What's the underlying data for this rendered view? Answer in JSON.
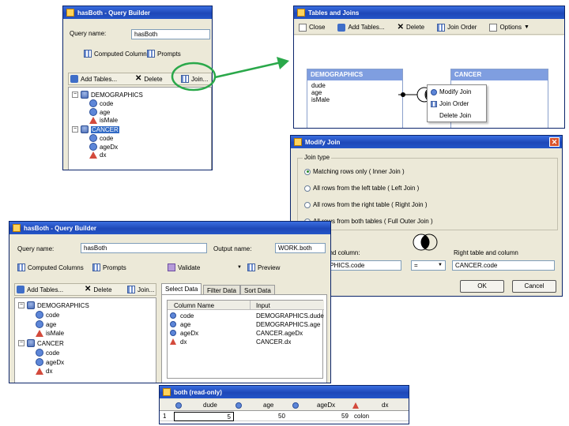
{
  "qb_top": {
    "title": "hasBoth - Query Builder",
    "query_name_label": "Query name:",
    "query_name_value": "hasBoth",
    "computed_columns": "Computed Columns",
    "prompts": "Prompts",
    "add_tables": "Add Tables...",
    "delete": "Delete",
    "join": "Join...",
    "tree": [
      {
        "label": "DEMOGRAPHICS",
        "kind": "table"
      },
      {
        "label": "code",
        "kind": "num"
      },
      {
        "label": "age",
        "kind": "num"
      },
      {
        "label": "isMale",
        "kind": "char"
      },
      {
        "label": "CANCER",
        "kind": "table"
      },
      {
        "label": "code",
        "kind": "num"
      },
      {
        "label": "ageDx",
        "kind": "num"
      },
      {
        "label": "dx",
        "kind": "char"
      }
    ]
  },
  "tj": {
    "title": "Tables and Joins",
    "close": "Close",
    "add_tables": "Add Tables...",
    "delete": "Delete",
    "join_order": "Join Order",
    "options": "Options",
    "demographics_title": "DEMOGRAPHICS",
    "demographics_cols": [
      "dude",
      "age",
      "isMale"
    ],
    "cancer_title": "CANCER",
    "menu": [
      "Modify Join",
      "Join Order",
      "Delete Join"
    ]
  },
  "mj": {
    "title": "Modify Join",
    "group_label": "Join type",
    "options": [
      "Matching rows only ( Inner Join )",
      "All rows from the left table ( Left Join )",
      "All rows from the right table ( Right Join )",
      "All rows from both tables ( Full Outer Join )"
    ],
    "left_label": "and column:",
    "left_value": "APHICS.code",
    "operator_value": "=",
    "right_label": "Right table and column",
    "right_value": "CANCER.code",
    "ok": "OK",
    "cancel": "Cancel"
  },
  "qb_bottom": {
    "title": "hasBoth - Query Builder",
    "query_name_label": "Query name:",
    "query_name_value": "hasBoth",
    "output_name_label": "Output name:",
    "output_name_value": "WORK.both",
    "computed_columns": "Computed Columns",
    "prompts": "Prompts",
    "validate": "Validate",
    "preview": "Preview",
    "add_tables": "Add Tables...",
    "delete": "Delete",
    "join": "Join...",
    "tree": [
      {
        "label": "DEMOGRAPHICS",
        "kind": "table"
      },
      {
        "label": "code",
        "kind": "num"
      },
      {
        "label": "age",
        "kind": "num"
      },
      {
        "label": "isMale",
        "kind": "char"
      },
      {
        "label": "CANCER",
        "kind": "table"
      },
      {
        "label": "code",
        "kind": "num"
      },
      {
        "label": "ageDx",
        "kind": "num"
      },
      {
        "label": "dx",
        "kind": "char"
      }
    ],
    "tabs": [
      "Select Data",
      "Filter Data",
      "Sort Data"
    ],
    "columns_header": [
      "Column Name",
      "Input"
    ],
    "rows": [
      {
        "name": "code",
        "input": "DEMOGRAPHICS.dude",
        "kind": "num"
      },
      {
        "name": "age",
        "input": "DEMOGRAPHICS.age",
        "kind": "num"
      },
      {
        "name": "ageDx",
        "input": "CANCER.ageDx",
        "kind": "num"
      },
      {
        "name": "dx",
        "input": "CANCER.dx",
        "kind": "char"
      }
    ]
  },
  "result": {
    "title": "both (read-only)",
    "headers": [
      "dude",
      "age",
      "ageDx",
      "dx"
    ],
    "row": [
      "1",
      "5",
      "50",
      "59",
      "colon"
    ]
  },
  "colors": {
    "annotation": "#2aa84a",
    "titlebar": "#2456c8"
  }
}
